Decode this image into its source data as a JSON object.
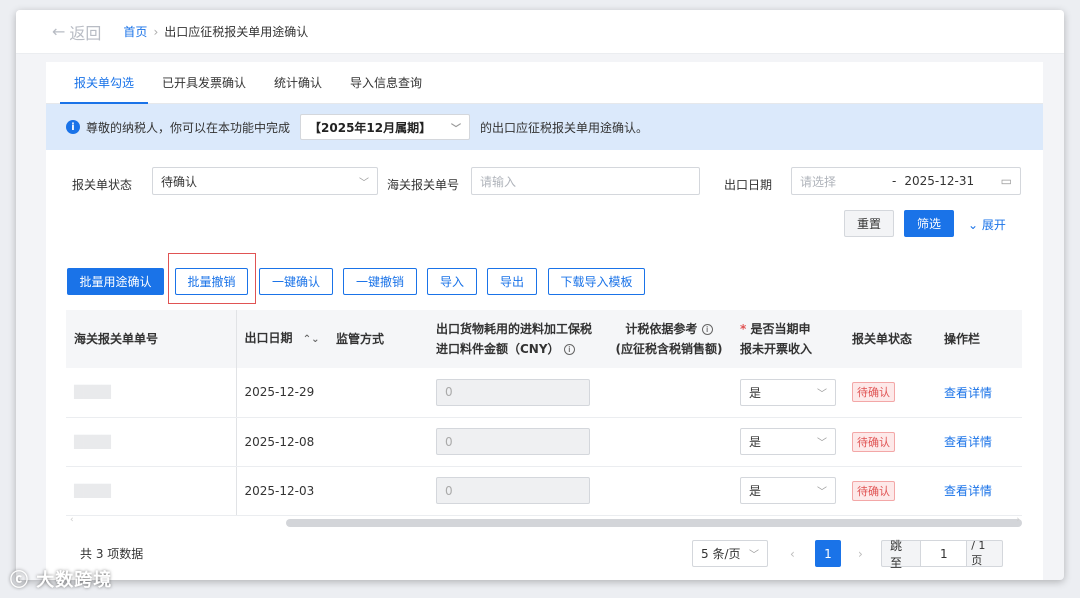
{
  "header": {
    "back_label": "返回",
    "breadcrumb_home": "首页",
    "breadcrumb_separator": "›",
    "breadcrumb_current": "出口应征税报关单用途确认"
  },
  "tabs": [
    {
      "label": "报关单勾选",
      "active": true
    },
    {
      "label": "已开具发票确认",
      "active": false
    },
    {
      "label": "统计确认",
      "active": false
    },
    {
      "label": "导入信息查询",
      "active": false
    }
  ],
  "notice": {
    "prefix": "尊敬的纳税人，你可以在本功能中完成",
    "period_value": "【2025年12月属期】",
    "suffix": "的出口应征税报关单用途确认。"
  },
  "filters": {
    "status_label": "报关单状态",
    "status_value": "待确认",
    "customs_no_label": "海关报关单号",
    "customs_no_placeholder": "请输入",
    "export_date_label": "出口日期",
    "date_start_placeholder": "请选择",
    "date_separator": "-",
    "date_end_value": "2025-12-31"
  },
  "filter_actions": {
    "reset": "重置",
    "filter": "筛选",
    "expand": "展开"
  },
  "toolbar": {
    "batch_confirm": "批量用途确认",
    "batch_cancel": "批量撤销",
    "one_click_confirm": "一键确认",
    "one_click_cancel": "一键撤销",
    "import": "导入",
    "export": "导出",
    "download_template": "下载导入模板"
  },
  "table": {
    "headers": {
      "customs_no": "海关报关单单号",
      "export_date": "出口日期",
      "supervision": "监管方式",
      "amount_line1": "出口货物耗用的进料加工保税",
      "amount_line2": "进口料件金额（CNY）",
      "tax_basis_line1": "计税依据参考",
      "tax_basis_line2": "(应征税含税销售额)",
      "required_mark": "*",
      "current_period_line1": "是否当期申",
      "current_period_line2": "报未开票收入",
      "status": "报关单状态",
      "actions": "操作栏"
    },
    "rows": [
      {
        "export_date": "2025-12-29",
        "amount": "0",
        "current_period": "是",
        "status": "待确认",
        "action": "查看详情"
      },
      {
        "export_date": "2025-12-08",
        "amount": "0",
        "current_period": "是",
        "status": "待确认",
        "action": "查看详情"
      },
      {
        "export_date": "2025-12-03",
        "amount": "0",
        "current_period": "是",
        "status": "待确认",
        "action": "查看详情"
      }
    ]
  },
  "pagination": {
    "total_text": "共 3 项数据",
    "page_size": "5 条/页",
    "current_page": "1",
    "jump_label": "跳至",
    "jump_value": "1",
    "total_pages_text": "/ 1 页"
  },
  "watermark": "大数跨境",
  "colors": {
    "primary": "#1a73e8",
    "notice_bg": "#dbe9fb",
    "status_red": "#e05353",
    "highlight_border": "#e05353"
  }
}
